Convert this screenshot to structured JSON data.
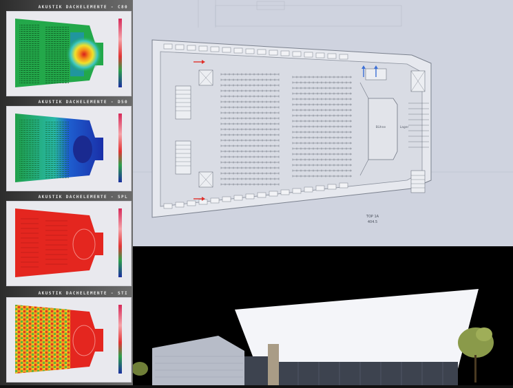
{
  "panels": [
    {
      "title": "AKUSTIK DACHELEMENTE - C80",
      "map": "c80"
    },
    {
      "title": "AKUSTIK DACHELEMENTE - D50",
      "map": "d50"
    },
    {
      "title": "AKUSTIK DACHELEMENTE - SPL",
      "map": "spl"
    },
    {
      "title": "AKUSTIK DACHELEMENTE - STI",
      "map": "sti"
    }
  ],
  "floor_plan": {
    "room_label_stage": "Bühne",
    "room_label_side": "Lager",
    "caption_line1": "TOP 1A",
    "caption_line2": "404.5",
    "arrow_red": "#e0302a",
    "arrow_blue": "#3b6fd6"
  },
  "colors": {
    "map_green": "#23a84a",
    "map_blue": "#1e3fb8",
    "map_red": "#e4261f",
    "building_white": "#f4f5f9",
    "glass_dark": "#3d434f",
    "tree": "#8a9a4a"
  }
}
